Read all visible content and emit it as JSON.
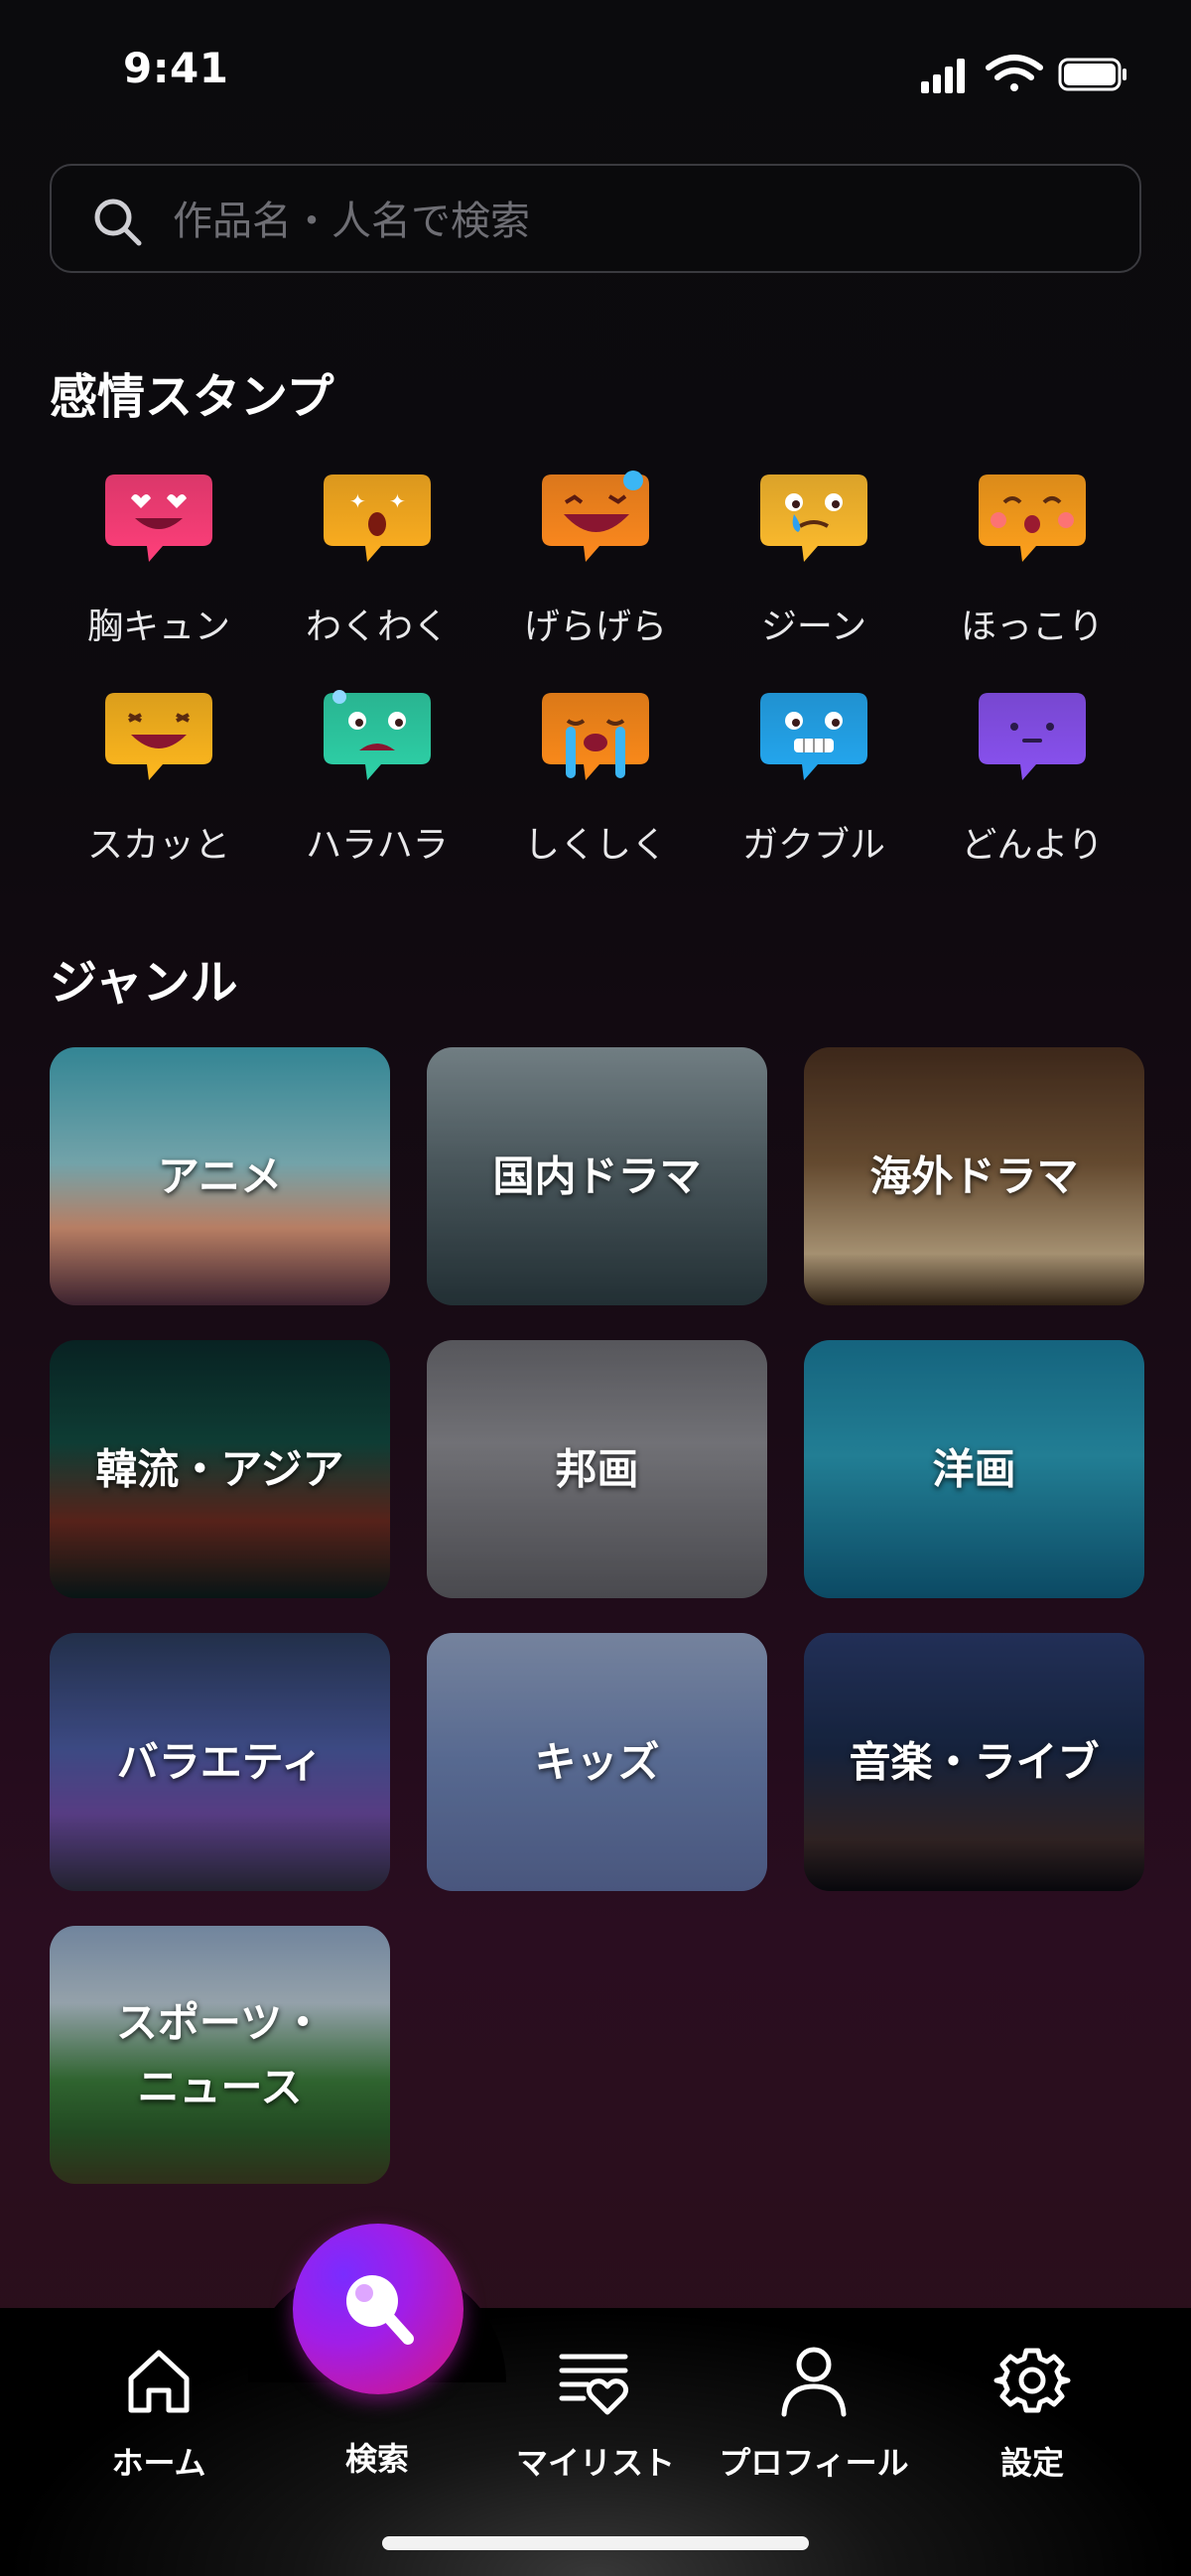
{
  "status": {
    "time": "9:41"
  },
  "search": {
    "placeholder": "作品名・人名で検索"
  },
  "stamps": {
    "title": "感情スタンプ",
    "items": [
      {
        "label": "胸キュン",
        "icon": "heart-eyes-face-icon",
        "color": "#ff3f7a"
      },
      {
        "label": "わくわく",
        "icon": "excited-face-icon",
        "color": "#ffb020"
      },
      {
        "label": "げらげら",
        "icon": "laughing-face-icon",
        "color": "#ff8a1e"
      },
      {
        "label": "ジーン",
        "icon": "touched-tear-face-icon",
        "color": "#ffbd2e"
      },
      {
        "label": "ほっこり",
        "icon": "warm-blush-face-icon",
        "color": "#ffa11c"
      },
      {
        "label": "スカッと",
        "icon": "refreshed-grin-face-icon",
        "color": "#ffb81e"
      },
      {
        "label": "ハラハラ",
        "icon": "nervous-face-icon",
        "color": "#2ed2a8"
      },
      {
        "label": "しくしく",
        "icon": "crying-face-icon",
        "color": "#ff8c1a"
      },
      {
        "label": "ガクブル",
        "icon": "shivering-face-icon",
        "color": "#24a9f2"
      },
      {
        "label": "どんより",
        "icon": "gloomy-face-icon",
        "color": "#8a52f2"
      }
    ]
  },
  "genres": {
    "title": "ジャンル",
    "items": [
      {
        "label": "アニメ"
      },
      {
        "label": "国内ドラマ"
      },
      {
        "label": "海外ドラマ"
      },
      {
        "label": "韓流・アジア"
      },
      {
        "label": "邦画"
      },
      {
        "label": "洋画"
      },
      {
        "label": "バラエティ"
      },
      {
        "label": "キッズ"
      },
      {
        "label": "音楽・ライブ"
      },
      {
        "label": "スポーツ・\nニュース"
      }
    ]
  },
  "tabbar": {
    "accent": "#b81fd0",
    "items": [
      {
        "label": "ホーム",
        "icon": "home-icon"
      },
      {
        "label": "検索",
        "icon": "search-icon"
      },
      {
        "label": "マイリスト",
        "icon": "mylist-heart-icon"
      },
      {
        "label": "プロフィール",
        "icon": "profile-icon"
      },
      {
        "label": "設定",
        "icon": "gear-icon"
      }
    ]
  }
}
